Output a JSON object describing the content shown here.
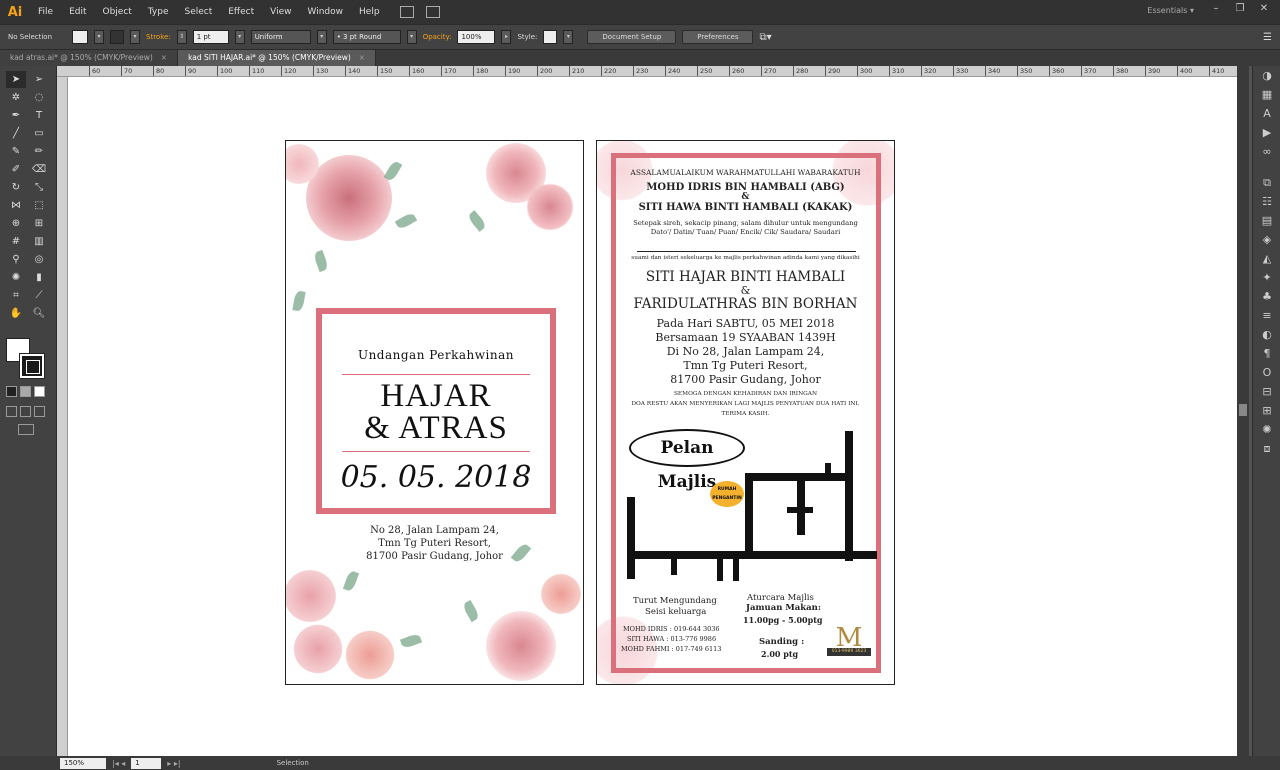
{
  "app": {
    "logo": "Ai",
    "workspace": "Essentials ▾"
  },
  "menu": [
    "File",
    "Edit",
    "Object",
    "Type",
    "Select",
    "Effect",
    "View",
    "Window",
    "Help"
  ],
  "control": {
    "selection": "No Selection",
    "stroke_label": "Stroke:",
    "stroke_value": "1 pt",
    "stroke_profile": "Uniform",
    "brush": "• 3 pt Round",
    "opacity_label": "Opacity:",
    "opacity_value": "100%",
    "style_label": "Style:",
    "document_setup": "Document Setup",
    "preferences": "Preferences"
  },
  "tabs": [
    {
      "label": "kad atras.ai* @ 150% (CMYK/Preview)",
      "close": "×"
    },
    {
      "label": "kad SITI HAJAR.ai* @ 150% (CMYK/Preview)",
      "close": "×"
    }
  ],
  "ruler": [
    "60",
    "70",
    "80",
    "90",
    "100",
    "110",
    "120",
    "130",
    "140",
    "150",
    "160",
    "170",
    "180",
    "190",
    "200",
    "210",
    "220",
    "230",
    "240",
    "250",
    "260",
    "270",
    "280",
    "290",
    "300",
    "310",
    "320",
    "330",
    "340",
    "350",
    "360",
    "370",
    "380",
    "390",
    "400",
    "410"
  ],
  "status": {
    "zoom": "150%",
    "page": "1",
    "tool": "Selection"
  },
  "left_card": {
    "title": "Undangan Perkahwinan",
    "name1": "HAJAR",
    "name2": "& ATRAS",
    "date": "05. 05. 2018",
    "addr1": "No 28, Jalan Lampam 24,",
    "addr2": "Tmn Tg Puteri Resort,",
    "addr3": "81700 Pasir Gudang, Johor"
  },
  "right_card": {
    "greeting": "ASSALAMUALAIKUM WARAHMATULLAHI WABARAKATUH",
    "host1": "MOHD IDRIS BIN HAMBALI (ABG)",
    "amp1": "&",
    "host2": "SITI HAWA BINTI HAMBALI (KAKAK)",
    "invite1": "Setepak sireh, sekacip pinang, salam dihulur untuk mengundang",
    "invite2": "Dato'/ Datin/ Tuan/ Puan/ Encik/ Cik/ Saudara/ Saudari",
    "intro": "suami dan isteri sekeluarga ke majlis perkahwinan adinda kami yang dikasihi",
    "bride": "SITI HAJAR BINTI HAMBALI",
    "amp2": "&",
    "groom": "FARIDULATHRAS BIN BORHAN",
    "d1": "Pada Hari SABTU, 05 MEI 2018",
    "d2": "Bersamaan 19 SYAABAN 1439H",
    "d3": "Di No 28, Jalan Lampam 24,",
    "d4": "Tmn Tg Puteri Resort,",
    "d5": "81700 Pasir Gudang, Johor",
    "prayer1": "SEMOGA DENGAN KEHADIRAN DAN IRINGAN",
    "prayer2": "DOA RESTU AKAN MENYERIKAN LAGI MAJLIS PENYATUAN DUA HATI INI.",
    "prayer3": "TERIMA KASIH.",
    "map_title": "Pelan Majlis",
    "rumah": "RUMAH PENGANTIN",
    "turut1": "Turut Mengundang",
    "turut2": "Seisi keluarga",
    "c1": "MOHD IDRIS : 019-644 3036",
    "c2": "SITI HAWA : 013-776 9986",
    "c3": "MOHD FAHMI : 017-749 6113",
    "acara": "Aturcara Majlis",
    "jamuan": "Jamuan Makan:",
    "jtime": "11.00pg - 5.00ptg",
    "sanding": "Sanding :",
    "stime": "2.00 ptg",
    "logo_letter": "M",
    "logo_phone": "013-9989 3623"
  },
  "colors": {
    "frame": "#d9707c",
    "accent": "#f7a21b"
  }
}
